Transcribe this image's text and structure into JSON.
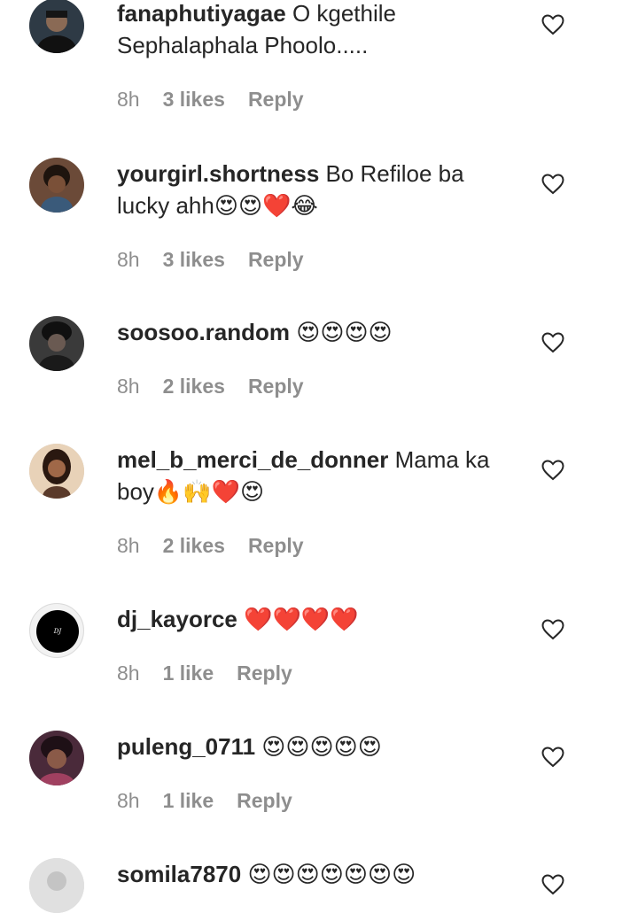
{
  "comments": [
    {
      "user": "fanaphutiyagae",
      "text": " O kgethile Sephalaphala Phoolo.....",
      "time": "8h",
      "likes": "3 likes",
      "reply": "Reply"
    },
    {
      "user": "yourgirl.shortness",
      "text": " Bo Refiloe ba lucky ahh😍😍❤️😂",
      "time": "8h",
      "likes": "3 likes",
      "reply": "Reply"
    },
    {
      "user": "soosoo.random",
      "text": " 😍😍😍😍",
      "time": "8h",
      "likes": "2 likes",
      "reply": "Reply"
    },
    {
      "user": "mel_b_merci_de_donner",
      "text": " Mama ka boy🔥🙌❤️😍",
      "time": "8h",
      "likes": "2 likes",
      "reply": "Reply"
    },
    {
      "user": "dj_kayorce",
      "text": " ❤️❤️❤️❤️",
      "time": "8h",
      "likes": "1 like",
      "reply": "Reply"
    },
    {
      "user": "puleng_0711",
      "text": " 😍😍😍😍😍",
      "time": "8h",
      "likes": "1 like",
      "reply": "Reply"
    },
    {
      "user": "somila7870",
      "text": " 😍😍😍😍😍😍😍",
      "time": "",
      "likes": "",
      "reply": ""
    }
  ],
  "avatars": [
    {
      "bg": "#2e3a45",
      "fg": "#1a1a1a"
    },
    {
      "bg": "#6b4a38",
      "fg": "#2a1a12"
    },
    {
      "bg": "#3a3a3a",
      "fg": "#151515"
    },
    {
      "bg": "#e8d2b8",
      "fg": "#3a2418"
    },
    {
      "bg": "#f2f2f2",
      "fg": "#000000"
    },
    {
      "bg": "#4a2a3a",
      "fg": "#1e1016"
    },
    {
      "bg": "#dddddd",
      "fg": "#c4c4c4"
    }
  ],
  "colors": {
    "text": "#262626",
    "meta": "#8e8e8e",
    "heart_outline": "#262626"
  }
}
